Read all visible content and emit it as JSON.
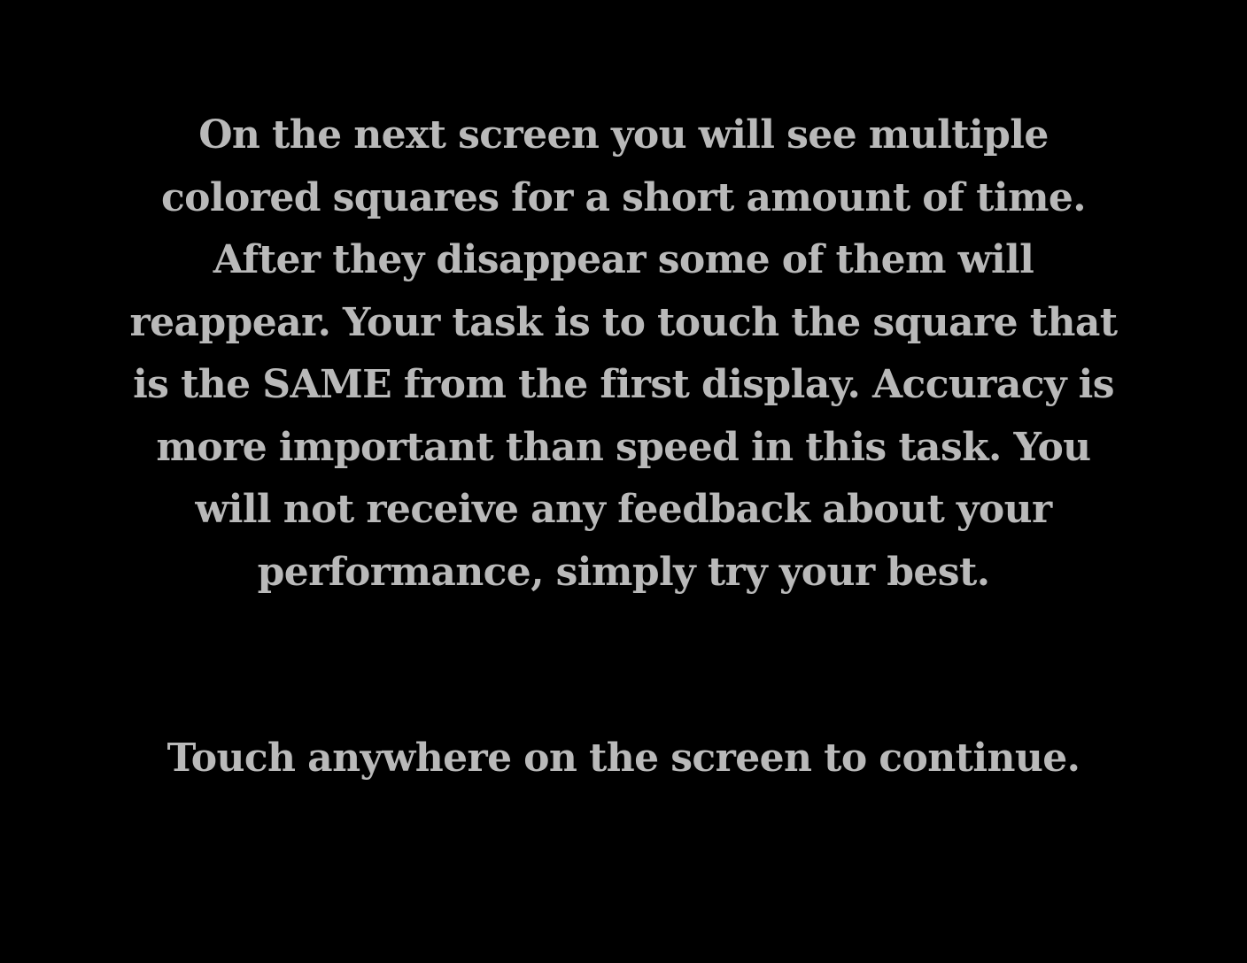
{
  "instructions_text": "On the next screen you will see multiple colored squares for a short amount of time. After they disappear some of them will reappear. Your task is to touch the square that is the SAME from the first display. Accuracy is more important than speed in this task. You will not receive any feedback about your performance, simply try your best.",
  "continue_prompt": "Touch anywhere on the screen to continue.",
  "colors": {
    "background": "#000000",
    "text": "#b9b9b9"
  }
}
